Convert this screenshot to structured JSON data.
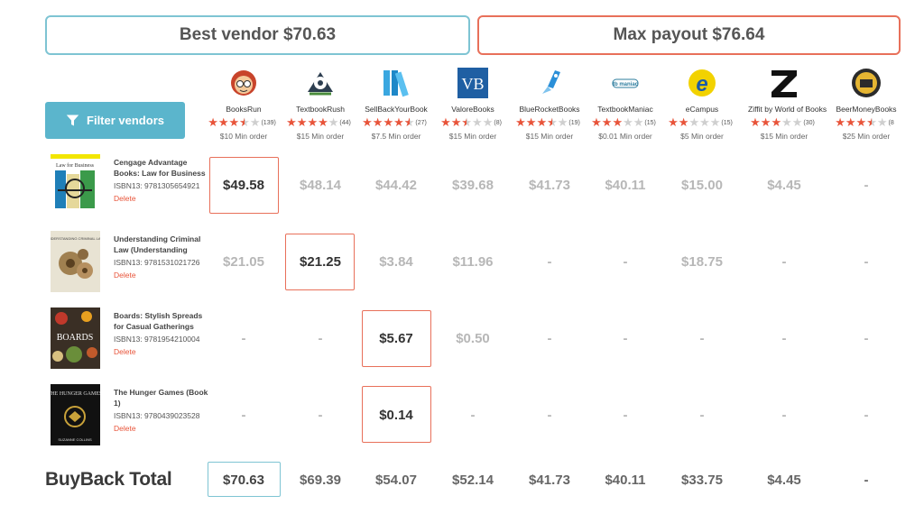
{
  "header": {
    "best_vendor_label": "Best vendor $70.63",
    "max_payout_label": "Max payout $76.64"
  },
  "filter": {
    "label": "Filter vendors"
  },
  "vendors": [
    {
      "name": "BooksRun",
      "stars": 3.5,
      "count": "(139)",
      "min": "$10 Min order",
      "icon": "booksrun-logo"
    },
    {
      "name": "TextbookRush",
      "stars": 4,
      "count": "(44)",
      "min": "$15 Min order",
      "icon": "textbookrush-logo"
    },
    {
      "name": "SellBackYourBook",
      "stars": 4.5,
      "count": "(27)",
      "min": "$7.5 Min order",
      "icon": "sellbackyourbook-logo"
    },
    {
      "name": "ValoreBooks",
      "stars": 2.5,
      "count": "(8)",
      "min": "$15 Min order",
      "icon": "valorebooks-logo"
    },
    {
      "name": "BlueRocketBooks",
      "stars": 3.5,
      "count": "(19)",
      "min": "$15 Min order",
      "icon": "bluerocketbooks-logo"
    },
    {
      "name": "TextbookManiac",
      "stars": 3,
      "count": "(15)",
      "min": "$0.01 Min order",
      "icon": "textbookmaniac-logo"
    },
    {
      "name": "eCampus",
      "stars": 2,
      "count": "(15)",
      "min": "$5 Min order",
      "icon": "ecampus-logo"
    },
    {
      "name": "Ziffit by World of Books",
      "stars": 3,
      "count": "(30)",
      "min": "$15 Min order",
      "icon": "ziffit-logo"
    },
    {
      "name": "BeerMoneyBooks",
      "stars": 3.5,
      "count": "(8",
      "min": "$25 Min order",
      "icon": "beermoneybooks-logo"
    }
  ],
  "books": [
    {
      "title": "Cengage Advantage Books: Law for Business",
      "isbn": "ISBN13: 9781305654921",
      "delete": "Delete",
      "prices": [
        "$49.58",
        "$48.14",
        "$44.42",
        "$39.68",
        "$41.73",
        "$40.11",
        "$15.00",
        "$4.45",
        "-"
      ],
      "best_index": 0
    },
    {
      "title": "Understanding Criminal Law (Understanding",
      "isbn": "ISBN13: 9781531021726",
      "delete": "Delete",
      "prices": [
        "$21.05",
        "$21.25",
        "$3.84",
        "$11.96",
        "-",
        "-",
        "$18.75",
        "-",
        "-"
      ],
      "best_index": 1
    },
    {
      "title": "Boards: Stylish Spreads for Casual Gatherings",
      "isbn": "ISBN13: 9781954210004",
      "delete": "Delete",
      "prices": [
        "-",
        "-",
        "$5.67",
        "$0.50",
        "-",
        "-",
        "-",
        "-",
        "-"
      ],
      "best_index": 2
    },
    {
      "title": "The Hunger Games (Book 1)",
      "isbn": "ISBN13: 9780439023528",
      "delete": "Delete",
      "prices": [
        "-",
        "-",
        "$0.14",
        "-",
        "-",
        "-",
        "-",
        "-",
        "-"
      ],
      "best_index": 2
    }
  ],
  "cover_text": {
    "book1": "Law for Business",
    "book2": "UNDERSTANDING CRIMINAL LAW",
    "book3": "BOARDS",
    "book4_a": "THE HUNGER GAMES",
    "book4_b": "SUZANNE COLLINS"
  },
  "totals": {
    "label": "BuyBack Total",
    "values": [
      "$70.63",
      "$69.39",
      "$54.07",
      "$52.14",
      "$41.73",
      "$40.11",
      "$33.75",
      "$4.45",
      "-"
    ]
  },
  "colors": {
    "accent_blue": "#5bb5cc",
    "accent_orange": "#e8705a",
    "star": "#e8543a"
  }
}
